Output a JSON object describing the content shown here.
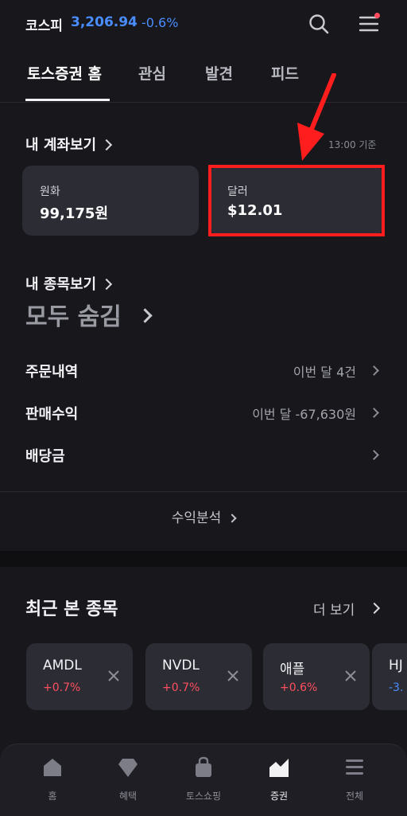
{
  "header": {
    "index_name": "코스피",
    "index_value": "3,206.94",
    "index_change": "-0.6%"
  },
  "tabs": [
    {
      "label": "토스증권 홈",
      "active": true
    },
    {
      "label": "관심",
      "active": false
    },
    {
      "label": "발견",
      "active": false
    },
    {
      "label": "피드",
      "active": false
    }
  ],
  "account": {
    "title": "내 계좌보기",
    "time": "13:00 기준",
    "cards": [
      {
        "label": "원화",
        "value": "99,175원"
      },
      {
        "label": "달러",
        "value": "$12.01"
      }
    ]
  },
  "holdings": {
    "title": "내 종목보기",
    "hidden_text": "모두 숨김"
  },
  "rows": [
    {
      "label": "주문내역",
      "value": "이번 달 4건"
    },
    {
      "label": "판매수익",
      "value": "이번 달 -67,630원"
    },
    {
      "label": "배당금",
      "value": ""
    }
  ],
  "analysis_label": "수익분석",
  "recent": {
    "title": "최근 본 종목",
    "more_label": "더 보기",
    "stocks": [
      {
        "name": "AMDL",
        "change": "+0.7%"
      },
      {
        "name": "NVDL",
        "change": "+0.7%"
      },
      {
        "name": "애플",
        "change": "+0.6%"
      },
      {
        "name": "HJ",
        "change": "-3."
      }
    ]
  },
  "bottom_nav": [
    {
      "label": "홈",
      "icon": "home-icon"
    },
    {
      "label": "혜택",
      "icon": "diamond-icon"
    },
    {
      "label": "토스쇼핑",
      "icon": "shopping-bag-icon"
    },
    {
      "label": "증권",
      "icon": "chart-icon",
      "active": true
    },
    {
      "label": "전체",
      "icon": "menu-icon"
    }
  ],
  "colors": {
    "background": "#17171c",
    "card": "#2c2c34",
    "up": "#ff4e5e",
    "down": "#4a8dff",
    "highlight": "#ff1d1d"
  }
}
